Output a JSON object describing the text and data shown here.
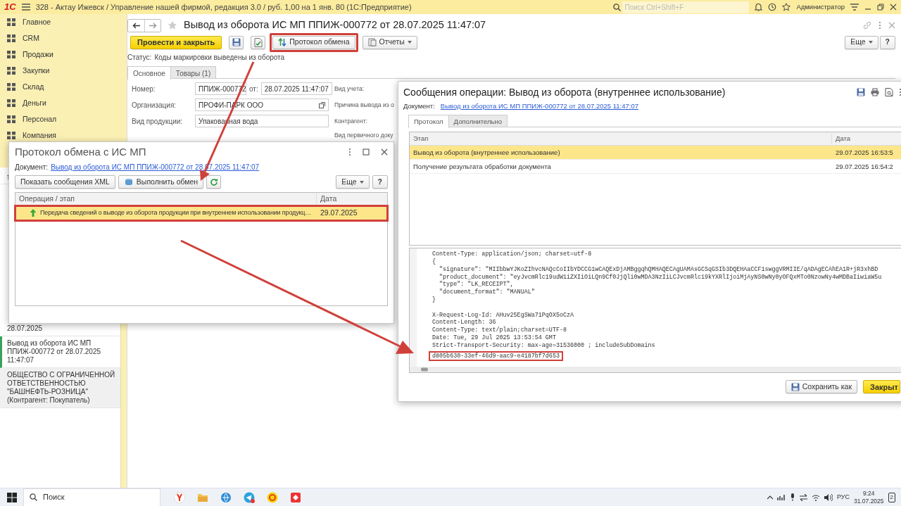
{
  "app_bar": {
    "logo": "1С",
    "title": "328 - Актау Ижевск / Управление нашей фирмой, редакция 3.0 / руб. 1,00 на 1 янв. 80  (1С:Предприятие)",
    "search_placeholder": "Поиск Ctrl+Shift+F",
    "user": "Администратор"
  },
  "sidebar": {
    "sections": [
      {
        "label": "Главное"
      },
      {
        "label": "CRM"
      },
      {
        "label": "Продажи"
      },
      {
        "label": "Закупки"
      },
      {
        "label": "Склад"
      },
      {
        "label": "Деньги"
      },
      {
        "label": "Персонал"
      },
      {
        "label": "Компания"
      }
    ],
    "open_windows": [
      {
        "text": "28.07.2025",
        "selected": false
      },
      {
        "text": "Вывод из оборота ИС МП ППИЖ-000772 от 28.07.2025 11:47:07",
        "selected": true
      },
      {
        "text": "ОБЩЕСТВО С ОГРАНИЧЕННОЙ ОТВЕТСТВЕННОСТЬЮ \"БАШНЕФТЬ-РОЗНИЦА\" (Контрагент: Покупатель)",
        "selected": false
      }
    ]
  },
  "document": {
    "title": "Вывод из оборота ИС МП ППИЖ-000772 от 28.07.2025 11:47:07",
    "toolbar": [
      {
        "kind": "primary",
        "label": "Провести и закрыть",
        "highlighted": false
      },
      {
        "kind": "save",
        "highlighted": false
      },
      {
        "kind": "post",
        "highlighted": false
      },
      {
        "kind": "exchange",
        "label": "Протокол обмена",
        "highlighted": true
      },
      {
        "kind": "reports",
        "label": "Отчеты",
        "highlighted": false
      }
    ],
    "more": "Еще",
    "help": "?",
    "status_label": "Статус:",
    "status": "Коды маркировки выведены из оборота",
    "tabs": [
      {
        "label": "Основное",
        "selected": true
      },
      {
        "label": "Товары (1)",
        "selected": false
      }
    ],
    "number_label": "Номер:",
    "number": "ППИЖ-000772",
    "date_label": "от:",
    "date": "28.07.2025 11:47:07",
    "fields": [
      {
        "label": "Организация:",
        "value": "ПРОФИ-ПАРК ООО"
      },
      {
        "label": "Вид продукции:",
        "value": "Упакованная вода"
      }
    ],
    "right_labels": [
      "Вид учета:",
      "Причина вывода из о",
      "Контрагент:",
      "Вид первичного доку"
    ]
  },
  "exchange_dialog": {
    "title": "Протокол обмена с ИС МП",
    "document_label": "Документ:",
    "document_link": "Вывод из оборота ИС МП ППИЖ-000772 от 28.07.2025 11:47:07",
    "buttons": [
      {
        "kind": "text",
        "label": "Показать сообщения XML"
      },
      {
        "kind": "exchange",
        "label": "Выполнить обмен"
      },
      {
        "kind": "refresh"
      }
    ],
    "more": "Еще",
    "help": "?",
    "columns": [
      "Операция / этап",
      "Дата"
    ],
    "rows": [
      {
        "operation": "Передача сведений о выводе из оборота продукции при внутреннем использовании продукц…",
        "date": "29.07.2025",
        "selected": true,
        "highlighted": true
      }
    ]
  },
  "messages_dialog": {
    "title": "Сообщения операции: Вывод из оборота (внутреннее использование)",
    "document_label": "Документ:",
    "document_link": "Вывод из оборота ИС МП ППИЖ-000772 от 28.07.2025 11:47:07",
    "tabs": [
      {
        "label": "Протокол",
        "selected": true
      },
      {
        "label": "Дополнительно",
        "selected": false
      }
    ],
    "columns": [
      "Этап",
      "Дата"
    ],
    "rows": [
      {
        "stage": "Вывод из оборота (внутреннее использование)",
        "date": "29.07.2025 16:53:5",
        "selected": true
      },
      {
        "stage": "Получение результата обработки документа",
        "date": "29.07.2025 16:54:2",
        "selected": false
      }
    ],
    "code_sections": [
      {
        "lines": [
          {
            "text": "Content-Type: application/json; charset=utf-8",
            "highlighted": false
          },
          {
            "text": "{",
            "highlighted": false
          },
          {
            "text": "  \"signature\": \"MIIbbwYJKoZIhvcNAQcCoIIbYDCCG1wCAQExDjAMBggqhQMHAQECAgUAMAsGCSqGSIb3DQEHAaCCF1swggVRMIIE/qADAgECAhEA1R+jR3xhBD",
            "highlighted": false
          },
          {
            "text": "  \"product_document\": \"eyJvcmRlc19udW1iZXIiOiLQn9Cf0JjQli0wMDA3NzIiLCJvcmRlc19kYXRlIjoiMjAyNS0wNy0yOFQxMTo0NzowNy4wMDBaIiwiaW5u",
            "highlighted": false
          },
          {
            "text": "  \"type\": \"LK_RECEIPT\",",
            "highlighted": false
          },
          {
            "text": "  \"document_format\": \"MANUAL\"",
            "highlighted": false
          },
          {
            "text": "}",
            "highlighted": false
          }
        ]
      },
      {
        "lines": [
          {
            "text": "X-Request-Log-Id: AHuv25EgSWa71PqOX5oCzA",
            "highlighted": false
          },
          {
            "text": "Content-Length: 36",
            "highlighted": false
          },
          {
            "text": "Content-Type: text/plain;charset=UTF-8",
            "highlighted": false
          },
          {
            "text": "Date: Tue, 29 Jul 2025 13:53:54 GMT",
            "highlighted": false
          },
          {
            "text": "Strict-Transport-Security: max-age=31536000 ; includeSubDomains",
            "highlighted": false
          },
          {
            "text": "d805b630-33ef-46d9-aac9-e4187bf7d653",
            "highlighted": true
          }
        ]
      }
    ],
    "save_as": "Сохранить как",
    "close": "Закрыт"
  },
  "taskbar": {
    "search": "Поиск",
    "language": "РУС",
    "time": "9:24",
    "date": "31.07.2025",
    "notifications": "2"
  }
}
